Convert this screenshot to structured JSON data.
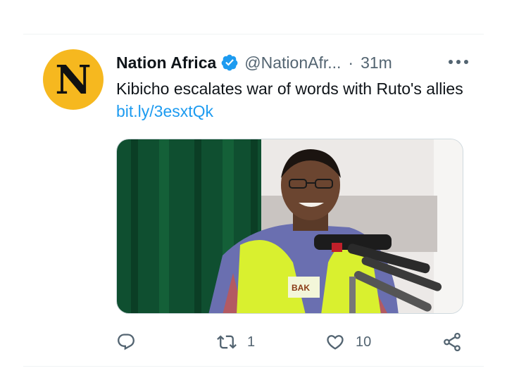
{
  "tweet": {
    "avatar_letter": "N",
    "author_name": "Nation Africa",
    "handle": "@NationAfr...",
    "separator": "·",
    "time_ago": "31m",
    "text": "Kibicho escalates war of words with Ruto's allies",
    "link": "bit.ly/3esxtQk"
  },
  "media": {
    "kind": "photo",
    "vest_text": "BAK"
  },
  "actions": {
    "reply_count": "",
    "retweet_count": "1",
    "like_count": "10"
  },
  "colors": {
    "accent": "#1d9bf0",
    "avatar_bg": "#f6b81f",
    "secondary_text": "#536471"
  },
  "icons": [
    "verified-badge-icon",
    "more-icon",
    "reply-icon",
    "retweet-icon",
    "like-icon",
    "share-icon"
  ]
}
